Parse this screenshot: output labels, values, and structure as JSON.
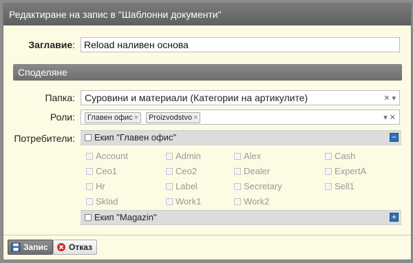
{
  "dialog": {
    "title": "Редактиране на запис в \"Шаблонни документи\""
  },
  "title_field": {
    "label": "Заглавие",
    "value": "Reload наливен основа"
  },
  "sharing_section": {
    "label": "Споделяне"
  },
  "folder_field": {
    "label": "Папка:",
    "value": "Суровини и материали (Категории на артикулите)"
  },
  "roles_field": {
    "label": "Роли:",
    "tags": [
      "Главен офис",
      "Proizvodstvo"
    ]
  },
  "users_field": {
    "label": "Потребители:",
    "groups": [
      {
        "name": "Екип \"Главен офис\"",
        "toggle": "−",
        "expanded": true,
        "users": [
          [
            "Account",
            "Admin",
            "Alex",
            "Cash"
          ],
          [
            "Ceo1",
            "Ceo2",
            "Dealer",
            "ExpertA"
          ],
          [
            "Hr",
            "Label",
            "Secretary",
            "Sell1"
          ],
          [
            "Sklad",
            "Work1",
            "Work2"
          ]
        ]
      },
      {
        "name": "Екип \"Magazin\"",
        "toggle": "+",
        "expanded": false
      }
    ]
  },
  "footer": {
    "save_label": "Запис",
    "cancel_label": "Отказ"
  },
  "colors": {
    "accent": "#2f6fb8",
    "titlebar": "#6b6b6b",
    "dialog_bg": "#fdfbe3",
    "cancel_icon": "#cc2a2a"
  }
}
